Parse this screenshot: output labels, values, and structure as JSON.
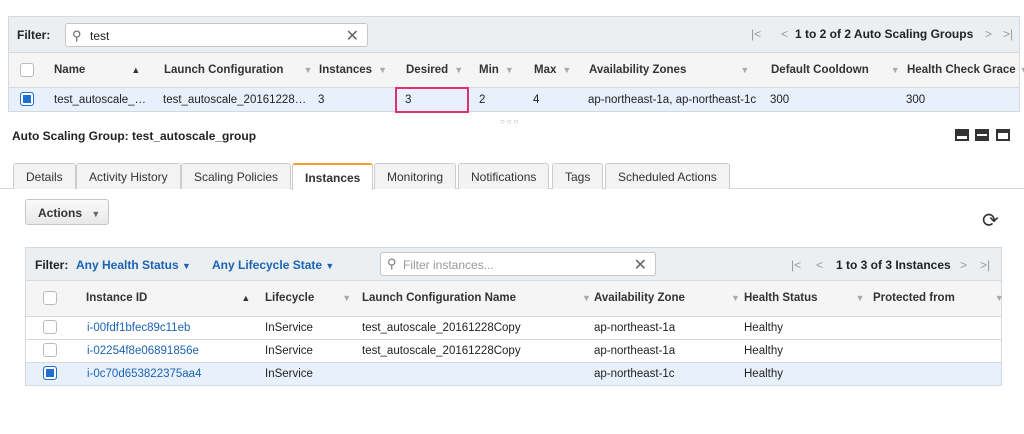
{
  "top_filter": {
    "label": "Filter:",
    "search_value": "test",
    "pager_text": "1 to 2 of 2 Auto Scaling Groups"
  },
  "top_table": {
    "columns": [
      "Name",
      "Launch Configuration",
      "Instances",
      "Desired",
      "Min",
      "Max",
      "Availability Zones",
      "Default Cooldown",
      "Health Check Grace"
    ],
    "row": {
      "name": "test_autoscale_…",
      "launch_config": "test_autoscale_20161228…",
      "instances": "3",
      "desired": "3",
      "min": "2",
      "max": "4",
      "zones": "ap-northeast-1a, ap-northeast-1c",
      "cooldown": "300",
      "grace": "300"
    }
  },
  "detail": {
    "title": "Auto Scaling Group: test_autoscale_group"
  },
  "tabs": [
    "Details",
    "Activity History",
    "Scaling Policies",
    "Instances",
    "Monitoring",
    "Notifications",
    "Tags",
    "Scheduled Actions"
  ],
  "active_tab": "Instances",
  "actions_label": "Actions",
  "instances": {
    "filter_label": "Filter:",
    "health_filter": "Any Health Status",
    "lifecycle_filter": "Any Lifecycle State",
    "search_placeholder": "Filter instances...",
    "pager_text": "1 to 3 of 3 Instances",
    "columns": [
      "Instance ID",
      "Lifecycle",
      "Launch Configuration Name",
      "Availability Zone",
      "Health Status",
      "Protected from"
    ],
    "rows": [
      {
        "id": "i-00fdf1bfec89c11eb",
        "lifecycle": "InService",
        "launch_config": "test_autoscale_20161228Copy",
        "zone": "ap-northeast-1a",
        "health": "Healthy"
      },
      {
        "id": "i-02254f8e06891856e",
        "lifecycle": "InService",
        "launch_config": "test_autoscale_20161228Copy",
        "zone": "ap-northeast-1a",
        "health": "Healthy"
      },
      {
        "id": "i-0c70d653822375aa4",
        "lifecycle": "InService",
        "launch_config": "",
        "zone": "ap-northeast-1c",
        "health": "Healthy"
      }
    ]
  },
  "colors": {
    "accent_link": "#1a63b5",
    "highlight": "#e0306e",
    "selected_row": "#e8f0fb",
    "active_tab": "#f0a035"
  }
}
